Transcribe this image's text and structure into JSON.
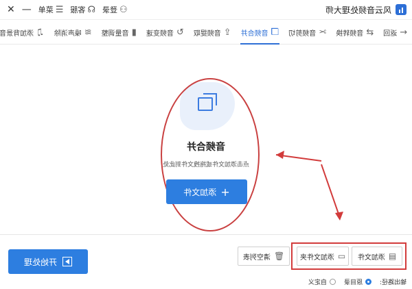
{
  "app": {
    "title": "风云音频处理大师"
  },
  "titlebar": {
    "login_label": "登录",
    "service_label": "客服",
    "menu_label": "菜单",
    "minimize_glyph": "—",
    "close_glyph": "✕"
  },
  "tabs": [
    {
      "label": "返回",
      "icon": "back-arrow-icon"
    },
    {
      "label": "音频转换",
      "icon": "convert-icon"
    },
    {
      "label": "音频剪切",
      "icon": "scissors-icon"
    },
    {
      "label": "音频合并",
      "icon": "merge-icon",
      "active": true
    },
    {
      "label": "音频提取",
      "icon": "extract-icon"
    },
    {
      "label": "音频变速",
      "icon": "speed-icon"
    },
    {
      "label": "音量调整",
      "icon": "volume-icon"
    },
    {
      "label": "噪声消除",
      "icon": "noise-icon"
    },
    {
      "label": "添加背景音乐",
      "icon": "music-note-icon"
    }
  ],
  "dropzone": {
    "title": "音频合并",
    "subtitle": "点击添加文件或拖拽文件到此处",
    "add_button": "添加文件",
    "add_plus": "+"
  },
  "bottom": {
    "add_file": "添加文件",
    "add_folder": "添加文件夹",
    "clear_list": "清空列表",
    "start": "开始处理"
  },
  "output": {
    "label": "输出路径:",
    "options": [
      "原目录",
      "自定义"
    ],
    "selected": "原目录"
  },
  "colors": {
    "accent": "#2d7ee0",
    "annotation": "#d23b3b"
  }
}
